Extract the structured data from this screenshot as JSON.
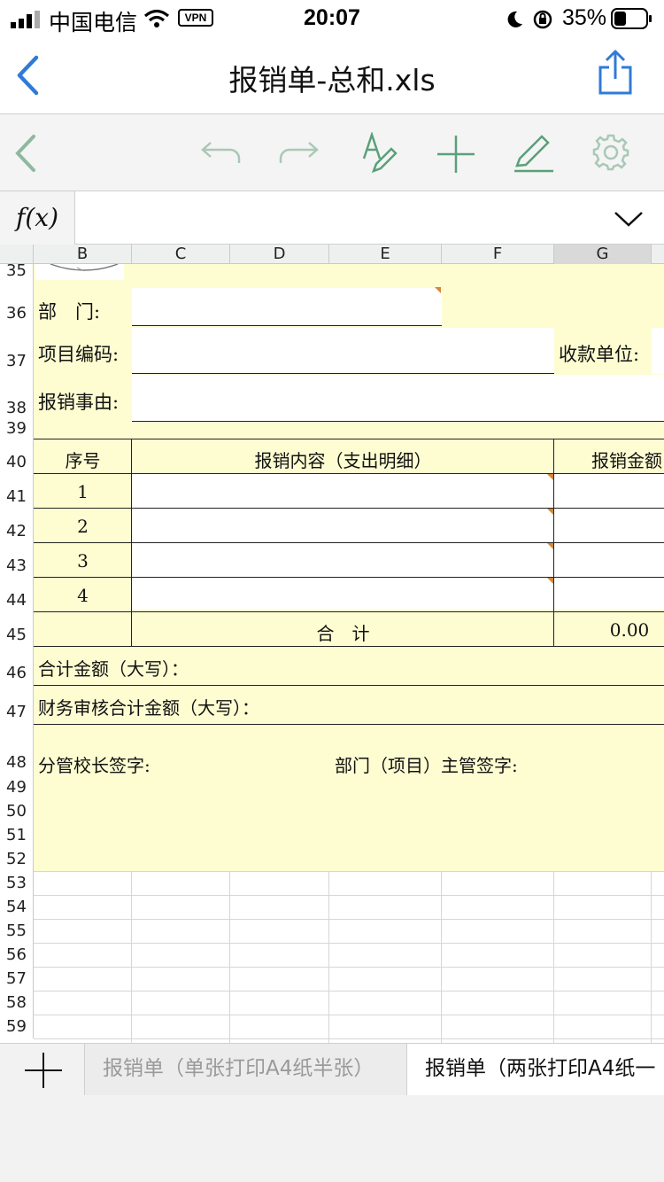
{
  "status": {
    "carrier": "中国电信",
    "vpn": "VPN",
    "time": "20:07",
    "battery": "35%"
  },
  "nav": {
    "title": "报销单-总和.xls",
    "back_icon": "chevron-left-icon",
    "share_icon": "share-icon"
  },
  "toolbar": {
    "icons": [
      "back-icon",
      "undo-icon",
      "redo-icon",
      "text-format-icon",
      "insert-icon",
      "pen-icon",
      "settings-icon"
    ]
  },
  "formula": {
    "fx": "f(x)",
    "value": ""
  },
  "columns": [
    "B",
    "C",
    "D",
    "E",
    "F",
    "G"
  ],
  "rows": [
    "35",
    "36",
    "37",
    "38",
    "39",
    "40",
    "41",
    "42",
    "43",
    "44",
    "45",
    "46",
    "47",
    "48",
    "49",
    "50",
    "51",
    "52",
    "53",
    "54",
    "55",
    "56",
    "57",
    "58",
    "59"
  ],
  "form": {
    "dept": "部　门:",
    "project_code": "项目编码:",
    "payee": "收款单位:",
    "reason": "报销事由:",
    "hdr_seq": "序号",
    "hdr_content": "报销内容（支出明细）",
    "hdr_amount": "报销金额",
    "items": [
      "1",
      "2",
      "3",
      "4"
    ],
    "total_label": "合　计",
    "total_value": "0.00",
    "amount_words": "合计金额（大写）：",
    "audit_words": "财务审核合计金额（大写）：",
    "sign_principal": "分管校长签字:",
    "sign_dept": "部门（项目）主管签字:"
  },
  "sheet_tabs": {
    "add": "+",
    "tab1": "报销单（单张打印A4纸半张）",
    "tab2": "报销单（两张打印A4纸一"
  },
  "colors": {
    "accent": "#2f7bd7",
    "form_fill": "#fefdd2",
    "toolbar_icon": "#5aa07a",
    "comment_marker": "#d3883a"
  }
}
